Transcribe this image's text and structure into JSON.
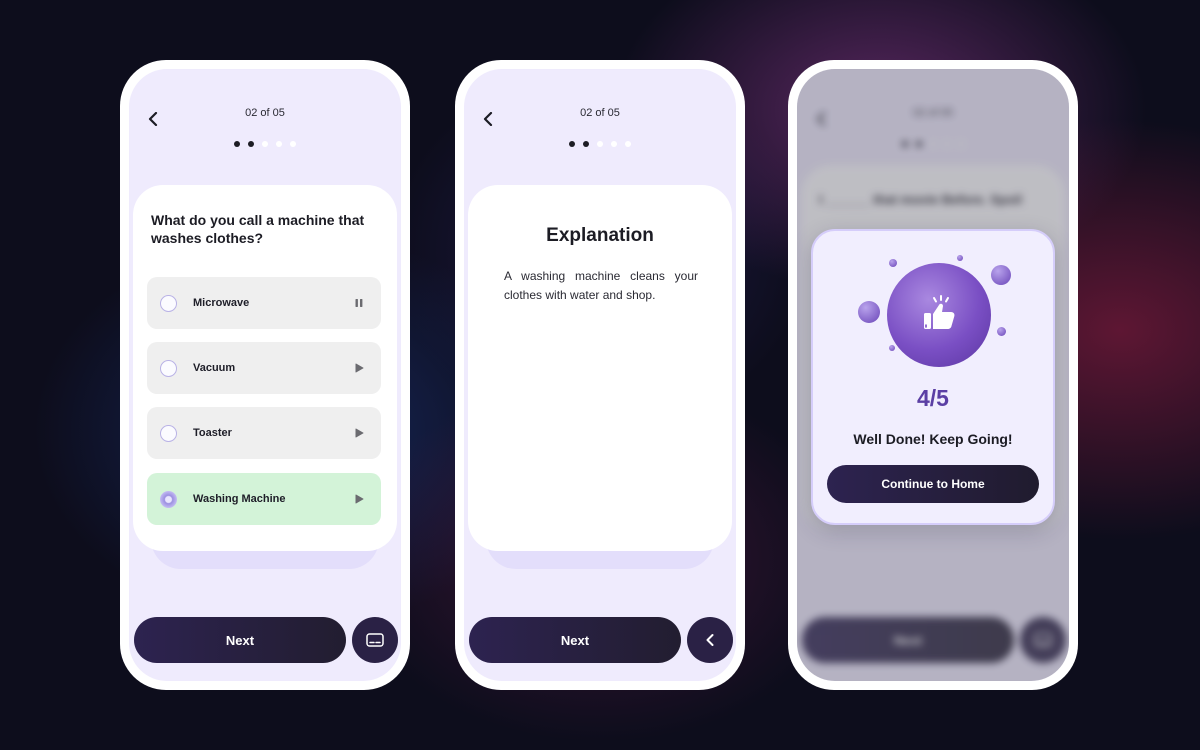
{
  "phone1": {
    "counter": "02 of 05",
    "question": "What do you call a machine that washes clothes?",
    "options": [
      {
        "label": "Microwave",
        "state": "default",
        "audio_icon": "pause-icon"
      },
      {
        "label": "Vacuum",
        "state": "default",
        "audio_icon": "play-icon"
      },
      {
        "label": "Toaster",
        "state": "default",
        "audio_icon": "play-icon"
      },
      {
        "label": "Washing Machine",
        "state": "correct",
        "audio_icon": "play-icon"
      }
    ],
    "next_label": "Next",
    "side_button_icon": "subtitles-icon"
  },
  "phone2": {
    "counter": "02 of 05",
    "explanation_title": "Explanation",
    "explanation_text": "A washing machine cleans your clothes with water and shop.",
    "next_label": "Next",
    "side_button_icon": "chevron-left-icon"
  },
  "phone3": {
    "counter": "02 of 05",
    "blurred_question": "I ______ that movie Before. Spoil",
    "score": "4/5",
    "message": "Well Done! Keep Going!",
    "home_button_label": "Continue to Home",
    "next_label": "Next",
    "illustration_icon": "thumbs-up-icon"
  },
  "progress": {
    "current": 2,
    "total": 5
  },
  "colors": {
    "accent": "#2a2145",
    "screen_bg": "#efebfd",
    "correct_option_bg": "#d3f3d8",
    "score_color": "#5b3fa4"
  }
}
